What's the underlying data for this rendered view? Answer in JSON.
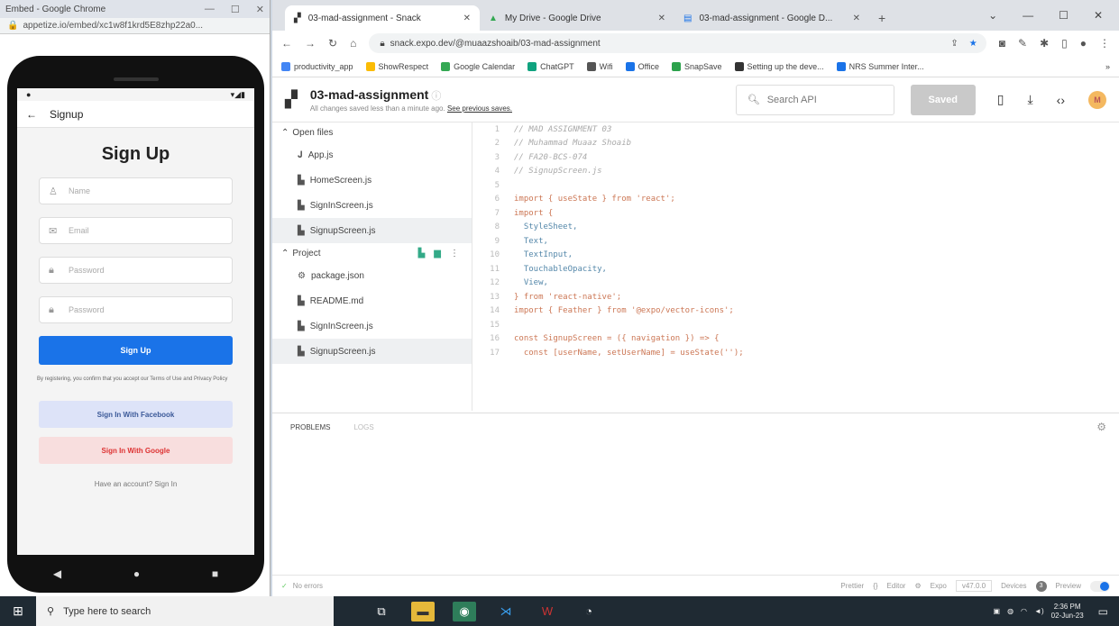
{
  "embed": {
    "title": "Embed - Google Chrome",
    "url": "appetize.io/embed/xc1w8f1krd5E8zhp22a0...",
    "app": {
      "header_title": "Signup",
      "heading": "Sign Up",
      "name_placeholder": "Name",
      "email_placeholder": "Email",
      "password_placeholder": "Password",
      "confirm_placeholder": "Password",
      "signup_button": "Sign Up",
      "terms_text": "By registering, you confirm that you accept our Terms of Use and Privacy Policy",
      "facebook_button": "Sign In With Facebook",
      "google_button": "Sign In With Google",
      "have_account": "Have an account? Sign In"
    }
  },
  "chrome": {
    "tabs": [
      {
        "label": "03-mad-assignment - Snack"
      },
      {
        "label": "My Drive - Google Drive"
      },
      {
        "label": "03-mad-assignment - Google D..."
      }
    ],
    "url": "snack.expo.dev/@muaazshoaib/03-mad-assignment",
    "bookmarks": [
      {
        "label": "productivity_app",
        "color": "#4285f4"
      },
      {
        "label": "ShowRespect",
        "color": "#fbbc05"
      },
      {
        "label": "Google Calendar",
        "color": "#34a853"
      },
      {
        "label": "ChatGPT",
        "color": "#10a37f"
      },
      {
        "label": "Wifi",
        "color": "#555555"
      },
      {
        "label": "Office",
        "color": "#1a73e8"
      },
      {
        "label": "SnapSave",
        "color": "#2ca24c"
      },
      {
        "label": "Setting up the deve...",
        "color": "#333333"
      },
      {
        "label": "NRS Summer Inter...",
        "color": "#1a73e8"
      }
    ]
  },
  "snack": {
    "project_name": "03-mad-assignment",
    "saved_info": "All changes saved less than a minute ago.",
    "see_previous": "See previous saves.",
    "search_placeholder": "Search API",
    "saved_button": "Saved",
    "avatar_initial": "M",
    "open_files_label": "Open files",
    "open_files": [
      "App.js",
      "HomeScreen.js",
      "SignInScreen.js",
      "SignupScreen.js"
    ],
    "project_label": "Project",
    "project_files": [
      "package.json",
      "README.md",
      "SignInScreen.js",
      "SignupScreen.js"
    ],
    "code_lines": [
      {
        "n": "1",
        "t": "// MAD ASSIGNMENT 03"
      },
      {
        "n": "2",
        "t": "// Muhammad Muaaz Shoaib"
      },
      {
        "n": "3",
        "t": "// FA20-BCS-074"
      },
      {
        "n": "4",
        "t": "// SignupScreen.js"
      },
      {
        "n": "5",
        "t": ""
      },
      {
        "n": "6",
        "t": "import { useState } from 'react';"
      },
      {
        "n": "7",
        "t": "import {"
      },
      {
        "n": "8",
        "t": "  StyleSheet,"
      },
      {
        "n": "9",
        "t": "  Text,"
      },
      {
        "n": "10",
        "t": "  TextInput,"
      },
      {
        "n": "11",
        "t": "  TouchableOpacity,"
      },
      {
        "n": "12",
        "t": "  View,"
      },
      {
        "n": "13",
        "t": "} from 'react-native';"
      },
      {
        "n": "14",
        "t": "import { Feather } from '@expo/vector-icons';"
      },
      {
        "n": "15",
        "t": ""
      },
      {
        "n": "16",
        "t": "const SignupScreen = ({ navigation }) => {"
      },
      {
        "n": "17",
        "t": "  const [userName, setUserName] = useState('');"
      }
    ],
    "panel_tabs": [
      "PROBLEMS",
      "LOGS"
    ],
    "footer": {
      "errors": "No errors",
      "prettier": "Prettier",
      "editor": "Editor",
      "expo": "Expo",
      "version": "v47.0.0",
      "devices": "Devices",
      "devices_count": "3",
      "preview": "Preview"
    }
  },
  "taskbar": {
    "search_placeholder": "Type here to search",
    "time": "2:36 PM",
    "date": "02-Jun-23"
  }
}
